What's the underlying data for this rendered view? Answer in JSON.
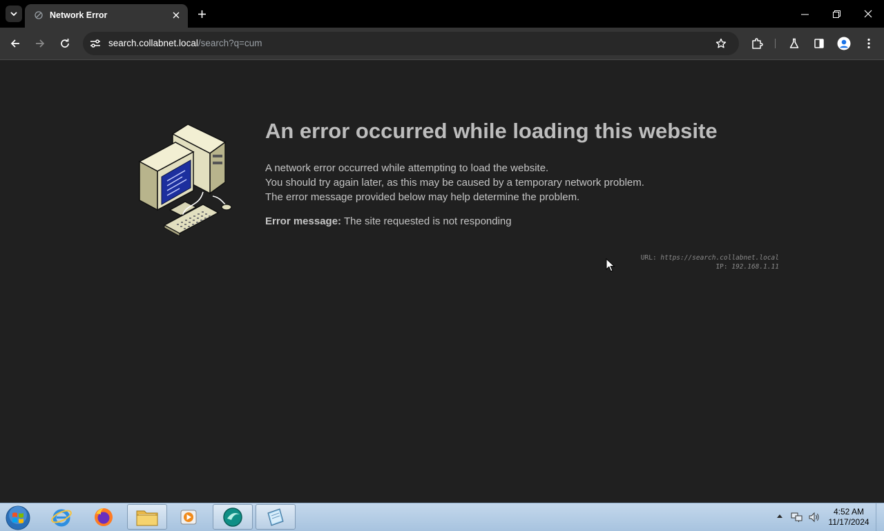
{
  "browser": {
    "tab_title": "Network Error",
    "url_host": "search.collabnet.local",
    "url_path": "/search?q=cum"
  },
  "page": {
    "title": "An error occurred while loading this website",
    "description_lines": [
      "A network error occurred while attempting to load the website.",
      "You should try again later, as this may be caused by a temporary network problem.",
      "The error message provided below may help determine the problem."
    ],
    "error_label": "Error message:",
    "error_text": "The site requested is not responding",
    "url_label": "URL:",
    "url_value": "https://search.collabnet.local",
    "ip_label": "IP:",
    "ip_value": "192.168.1.11"
  },
  "taskbar": {
    "apps": [
      "internet-explorer",
      "firefox",
      "file-explorer",
      "media-player",
      "browser-app",
      "notepad-app"
    ],
    "clock_time": "4:52 AM",
    "clock_date": "11/17/2024"
  },
  "colors": {
    "page_background": "#202020",
    "title_color": "#bdbdbd",
    "toolbar": "#353535",
    "tabbar": "#000000"
  }
}
